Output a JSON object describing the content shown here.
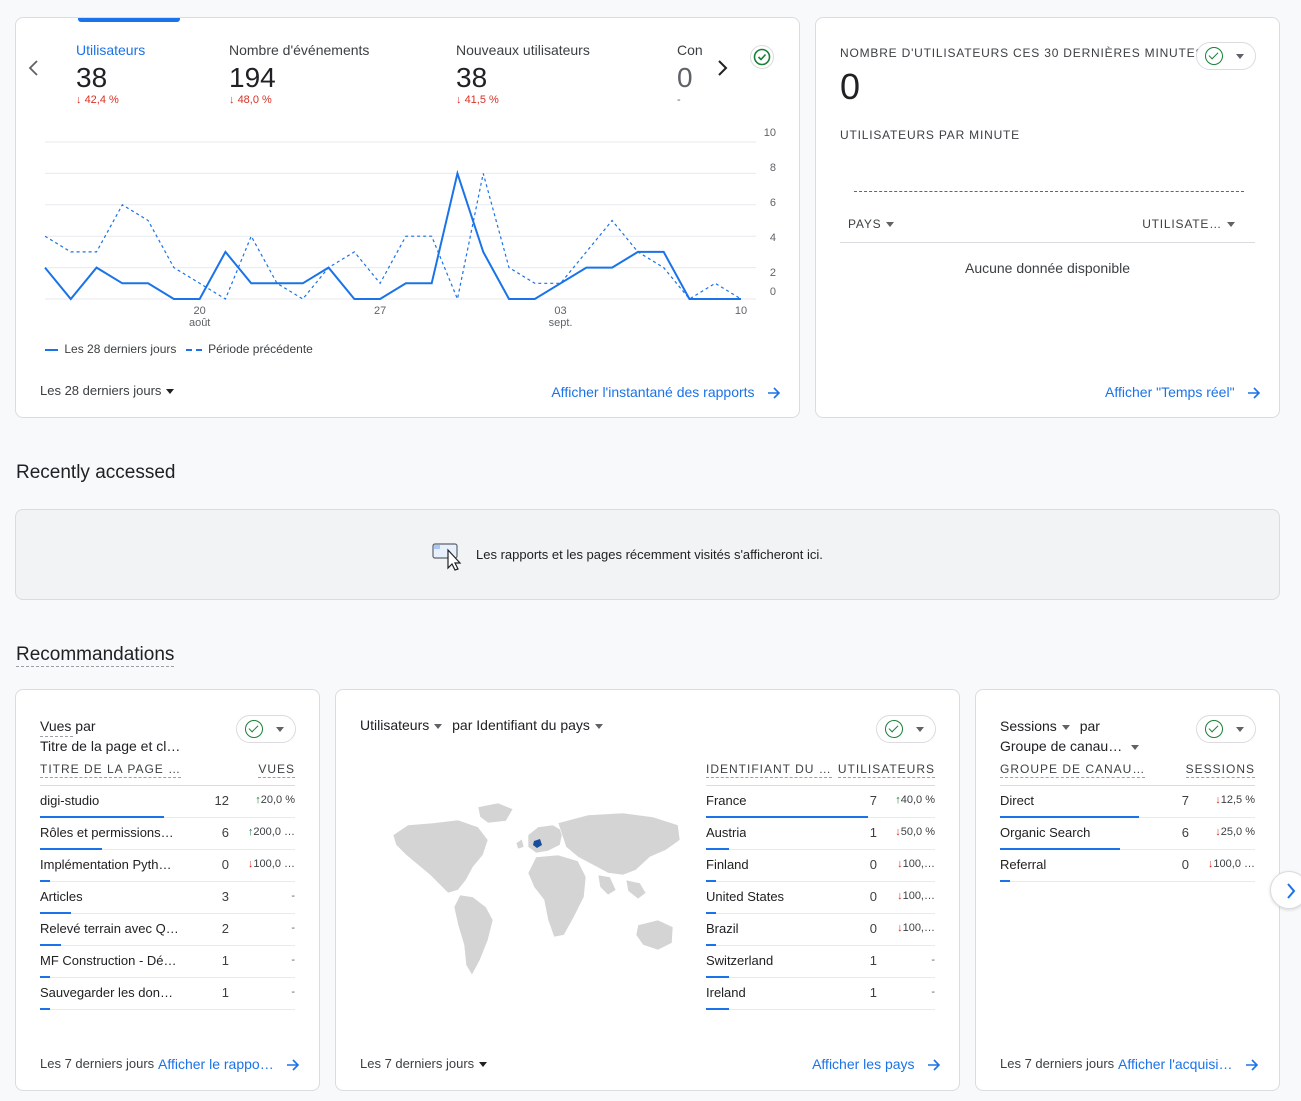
{
  "overview": {
    "metrics": [
      {
        "label": "Utilisateurs",
        "value": "38",
        "delta": "42,4 %"
      },
      {
        "label": "Nombre d'événements",
        "value": "194",
        "delta": "48,0 %"
      },
      {
        "label": "Nouveaux utilisateurs",
        "value": "38",
        "delta": "41,5 %"
      },
      {
        "label": "Con",
        "value": "0",
        "delta": "-"
      }
    ],
    "legend_current": "Les 28 derniers jours",
    "legend_previous": "Période précédente",
    "date_range": "Les 28 derniers jours",
    "link": "Afficher l'instantané des rapports"
  },
  "chart_data": {
    "type": "line",
    "x_ticks": [
      {
        "label": "20",
        "sub": "août",
        "index": 7
      },
      {
        "label": "27",
        "sub": "",
        "index": 14
      },
      {
        "label": "03",
        "sub": "sept.",
        "index": 21
      },
      {
        "label": "10",
        "sub": "",
        "index": 28
      }
    ],
    "y_ticks": [
      0,
      2,
      4,
      6,
      8,
      10
    ],
    "ylim": [
      0,
      10
    ],
    "series": [
      {
        "name": "Les 28 derniers jours",
        "style": "solid",
        "values": [
          2,
          0,
          2,
          1,
          1,
          0,
          0,
          3,
          1,
          1,
          1,
          2,
          0,
          0,
          1,
          1,
          8,
          3,
          0,
          0,
          1,
          2,
          2,
          3,
          3,
          0,
          0,
          0
        ]
      },
      {
        "name": "Période précédente",
        "style": "dashed",
        "values": [
          4,
          3,
          3,
          6,
          5,
          2,
          1,
          0,
          4,
          1,
          0,
          2,
          3,
          1,
          4,
          4,
          0,
          8,
          2,
          1,
          1,
          3,
          5,
          3,
          2,
          0,
          1,
          0
        ]
      }
    ],
    "colors": {
      "line": "#1a73e8",
      "grid": "#e8eaed"
    }
  },
  "realtime": {
    "title": "NOMBRE D'UTILISATEURS CES 30 DERNIÈRES MINUTES",
    "value": "0",
    "per_minute": "UTILISATEURS PAR MINUTE",
    "col_country": "PAYS",
    "col_users": "UTILISATE…",
    "empty": "Aucune donnée disponible",
    "link": "Afficher \"Temps réel\""
  },
  "recent": {
    "heading": "Recently accessed",
    "message": "Les rapports et les pages récemment visités s'afficheront ici."
  },
  "reco": {
    "heading": "Recommandations",
    "views": {
      "title_line1": "Vues par",
      "title_line2": "Titre de la page et cl…",
      "col1": "TITRE DE LA PAGE …",
      "col2": "VUES",
      "rows": [
        {
          "name": "digi-studio",
          "value": "12",
          "delta": "20,0 %",
          "dir": "up",
          "bar": 1.0
        },
        {
          "name": "Rôles et permissions…",
          "value": "6",
          "delta": "200,0 …",
          "dir": "up",
          "bar": 0.5
        },
        {
          "name": "Implémentation Pyth…",
          "value": "0",
          "delta": "100,0 …",
          "dir": "down",
          "bar": 0.0
        },
        {
          "name": "Articles",
          "value": "3",
          "delta": "-",
          "dir": "none",
          "bar": 0.25
        },
        {
          "name": "Relevé terrain avec Q…",
          "value": "2",
          "delta": "-",
          "dir": "none",
          "bar": 0.17
        },
        {
          "name": "MF Construction - Dé…",
          "value": "1",
          "delta": "-",
          "dir": "none",
          "bar": 0.08
        },
        {
          "name": "Sauvegarder les don…",
          "value": "1",
          "delta": "-",
          "dir": "none",
          "bar": 0.08
        }
      ],
      "date_range": "Les 7 derniers jours",
      "link": "Afficher le rappo…"
    },
    "country": {
      "title_metric": "Utilisateurs",
      "title_dim": "par Identifiant du pays",
      "col1": "IDENTIFIANT DU …",
      "col2": "UTILISATEURS",
      "rows": [
        {
          "name": "France",
          "value": "7",
          "delta": "40,0 %",
          "dir": "up",
          "bar": 1.0
        },
        {
          "name": "Austria",
          "value": "1",
          "delta": "50,0 %",
          "dir": "down",
          "bar": 0.14
        },
        {
          "name": "Finland",
          "value": "0",
          "delta": "100,…",
          "dir": "down",
          "bar": 0.0
        },
        {
          "name": "United States",
          "value": "0",
          "delta": "100,…",
          "dir": "down",
          "bar": 0.0
        },
        {
          "name": "Brazil",
          "value": "0",
          "delta": "100,…",
          "dir": "down",
          "bar": 0.0
        },
        {
          "name": "Switzerland",
          "value": "1",
          "delta": "-",
          "dir": "none",
          "bar": 0.14
        },
        {
          "name": "Ireland",
          "value": "1",
          "delta": "-",
          "dir": "none",
          "bar": 0.14
        }
      ],
      "date_range": "Les 7 derniers jours",
      "link": "Afficher les pays"
    },
    "sessions": {
      "title_metric": "Sessions",
      "title_par": "par",
      "title_dim": "Groupe de canau…",
      "col1": "GROUPE DE CANAU…",
      "col2": "SESSIONS",
      "rows": [
        {
          "name": "Direct",
          "value": "7",
          "delta": "12,5 %",
          "dir": "down",
          "bar": 1.0
        },
        {
          "name": "Organic Search",
          "value": "6",
          "delta": "25,0 %",
          "dir": "down",
          "bar": 0.86
        },
        {
          "name": "Referral",
          "value": "0",
          "delta": "100,0 …",
          "dir": "down",
          "bar": 0.0
        }
      ],
      "date_range": "Les 7 derniers jours",
      "link": "Afficher l'acquisi…"
    }
  }
}
